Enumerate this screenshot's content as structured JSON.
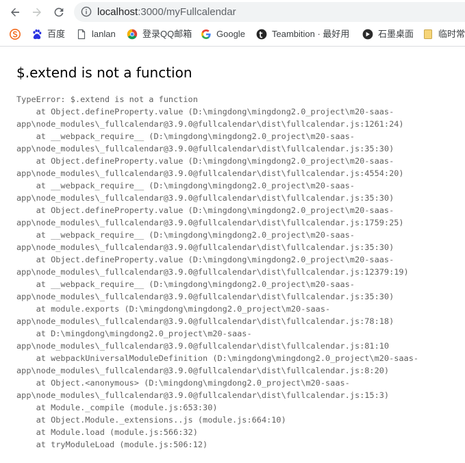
{
  "browser": {
    "url_host": "localhost",
    "url_rest": ":3000/myFullcalendar"
  },
  "bookmarks": [
    {
      "label": "",
      "icon": "s-logo-icon"
    },
    {
      "label": "百度",
      "icon": "baidu-paw-icon"
    },
    {
      "label": "lanlan",
      "icon": "page-icon"
    },
    {
      "label": "登录QQ邮箱",
      "icon": "chrome-icon"
    },
    {
      "label": "Google",
      "icon": "google-icon"
    },
    {
      "label": "Teambition · 最好用",
      "icon": "teambition-icon"
    },
    {
      "label": "石墨桌面",
      "icon": "shimo-icon"
    },
    {
      "label": "临时常",
      "icon": "folder-icon"
    }
  ],
  "error": {
    "title": "$.extend is not a function",
    "stack": [
      "TypeError: $.extend is not a function",
      "    at Object.defineProperty.value (D:\\mingdong\\mingdong2.0_project\\m20-saas-",
      "app\\node_modules\\_fullcalendar@3.9.0@fullcalendar\\dist\\fullcalendar.js:1261:24)",
      "    at __webpack_require__ (D:\\mingdong\\mingdong2.0_project\\m20-saas-",
      "app\\node_modules\\_fullcalendar@3.9.0@fullcalendar\\dist\\fullcalendar.js:35:30)",
      "    at Object.defineProperty.value (D:\\mingdong\\mingdong2.0_project\\m20-saas-",
      "app\\node_modules\\_fullcalendar@3.9.0@fullcalendar\\dist\\fullcalendar.js:4554:20)",
      "    at __webpack_require__ (D:\\mingdong\\mingdong2.0_project\\m20-saas-",
      "app\\node_modules\\_fullcalendar@3.9.0@fullcalendar\\dist\\fullcalendar.js:35:30)",
      "    at Object.defineProperty.value (D:\\mingdong\\mingdong2.0_project\\m20-saas-",
      "app\\node_modules\\_fullcalendar@3.9.0@fullcalendar\\dist\\fullcalendar.js:1759:25)",
      "    at __webpack_require__ (D:\\mingdong\\mingdong2.0_project\\m20-saas-",
      "app\\node_modules\\_fullcalendar@3.9.0@fullcalendar\\dist\\fullcalendar.js:35:30)",
      "    at Object.defineProperty.value (D:\\mingdong\\mingdong2.0_project\\m20-saas-",
      "app\\node_modules\\_fullcalendar@3.9.0@fullcalendar\\dist\\fullcalendar.js:12379:19)",
      "    at __webpack_require__ (D:\\mingdong\\mingdong2.0_project\\m20-saas-",
      "app\\node_modules\\_fullcalendar@3.9.0@fullcalendar\\dist\\fullcalendar.js:35:30)",
      "    at module.exports (D:\\mingdong\\mingdong2.0_project\\m20-saas-",
      "app\\node_modules\\_fullcalendar@3.9.0@fullcalendar\\dist\\fullcalendar.js:78:18)",
      "    at D:\\mingdong\\mingdong2.0_project\\m20-saas-",
      "app\\node_modules\\_fullcalendar@3.9.0@fullcalendar\\dist\\fullcalendar.js:81:10",
      "    at webpackUniversalModuleDefinition (D:\\mingdong\\mingdong2.0_project\\m20-saas-",
      "app\\node_modules\\_fullcalendar@3.9.0@fullcalendar\\dist\\fullcalendar.js:8:20)",
      "    at Object.<anonymous> (D:\\mingdong\\mingdong2.0_project\\m20-saas-",
      "app\\node_modules\\_fullcalendar@3.9.0@fullcalendar\\dist\\fullcalendar.js:15:3)",
      "    at Module._compile (module.js:653:30)",
      "    at Object.Module._extensions..js (module.js:664:10)",
      "    at Module.load (module.js:566:32)",
      "    at tryModuleLoad (module.js:506:12)"
    ]
  },
  "colors": {
    "stack_text": "#606060",
    "title_text": "#000000",
    "omnibox_bg": "#f1f3f4"
  }
}
